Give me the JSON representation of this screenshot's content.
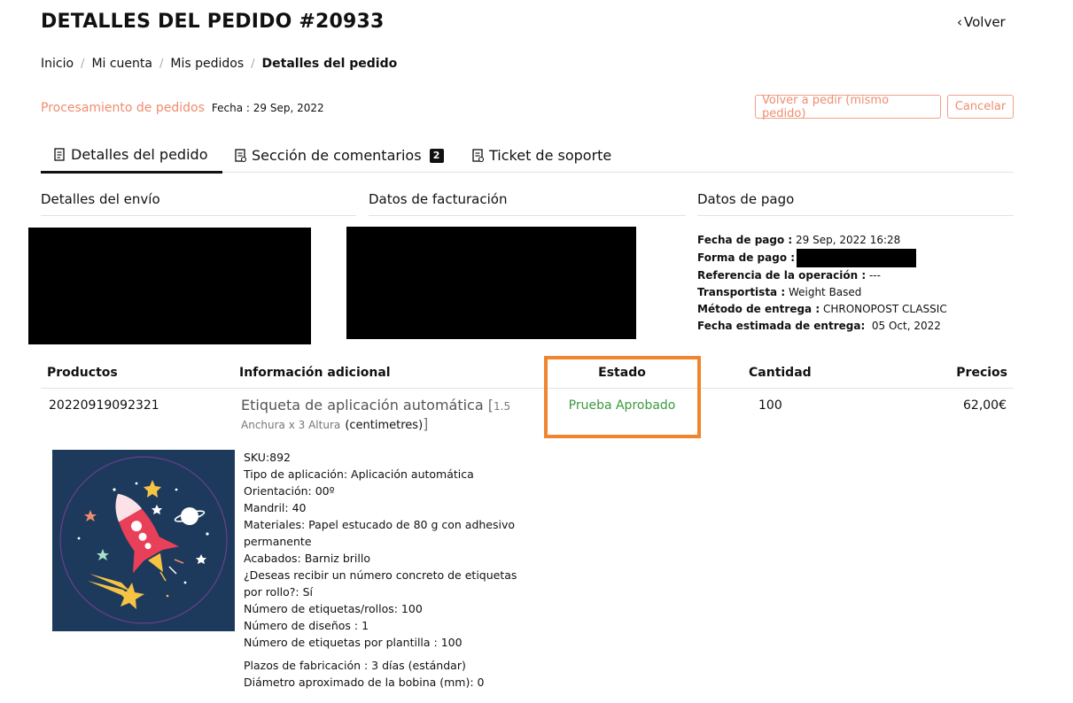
{
  "header": {
    "title": "DETALLES DEL PEDIDO #20933",
    "back_label": "Volver"
  },
  "breadcrumb": {
    "items": [
      "Inicio",
      "Mi cuenta",
      "Mis pedidos"
    ],
    "current": "Detalles del pedido"
  },
  "order_status": {
    "status": "Procesamiento de pedidos",
    "date": "Fecha : 29 Sep, 2022"
  },
  "actions": {
    "reorder_label": "Volver a pedir (mismo pedido)",
    "cancel_label": "Cancelar"
  },
  "tabs": [
    {
      "label": "Detalles del pedido",
      "active": true
    },
    {
      "label": "Sección de comentarios",
      "badge": "2"
    },
    {
      "label": "Ticket de soporte"
    }
  ],
  "sections": {
    "shipping": "Detalles del envío",
    "billing": "Datos de facturación",
    "payment": "Datos de pago"
  },
  "payment": {
    "fecha_label": "Fecha de pago :",
    "fecha_value": "29 Sep, 2022 16:28",
    "forma_label": "Forma de pago :",
    "referencia_label": "Referencia de la operación :",
    "referencia_value": "---",
    "transportista_label": "Transportista :",
    "transportista_value": "Weight Based",
    "metodo_label": "Método de entrega :",
    "metodo_value": "CHRONOPOST CLASSIC",
    "estimada_label": "Fecha estimada de entrega:",
    "estimada_value": "05 Oct, 2022"
  },
  "table": {
    "headers": {
      "productos": "Productos",
      "info": "Información adicional",
      "estado": "Estado",
      "cantidad": "Cantidad",
      "precios": "Precios"
    },
    "row": {
      "product_id": "20220919092321",
      "name": "Etiqueta de aplicación automática",
      "size_open": "[",
      "size_value": "1.5 Anchura x 3 Altura",
      "size_unit": "(centimetres)",
      "size_close": "]",
      "status": "Prueba Aprobado",
      "quantity": "100",
      "price": "62,00€"
    }
  },
  "specs": [
    "SKU:892",
    "Tipo de aplicación: Aplicación automática",
    "Orientación: 00º",
    "Mandril: 40",
    "Materiales: Papel estucado de 80 g con adhesivo permanente",
    "Acabados: Barniz brillo",
    "¿Deseas recibir un número concreto de etiquetas por rollo?: Sí",
    "Número de etiquetas/rollos: 100",
    "Número de diseños : 1",
    "Número de etiquetas por plantilla : 100"
  ],
  "specs_extra": [
    "Plazos de fabricación : 3 días (estándar)",
    "Diámetro aproximado de la bobina (mm): 0"
  ]
}
